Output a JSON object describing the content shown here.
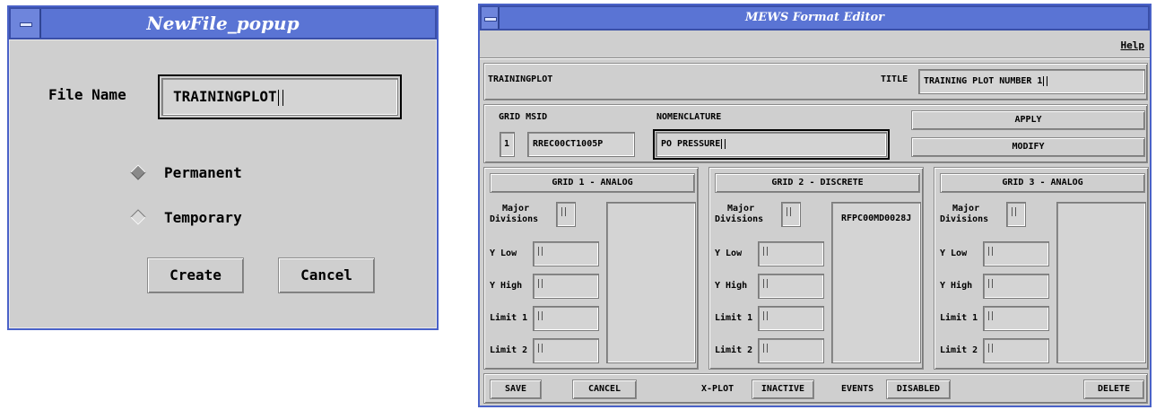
{
  "newfile_popup": {
    "title": "NewFile_popup",
    "file_name_label": "File Name",
    "file_name_value": "TRAININGPLOT",
    "options": [
      {
        "label": "Permanent",
        "selected": true
      },
      {
        "label": "Temporary",
        "selected": false
      }
    ],
    "create_label": "Create",
    "cancel_label": "Cancel"
  },
  "editor": {
    "title": "MEWS Format Editor",
    "help_label": "Help",
    "format_name": "TRAININGPLOT",
    "title_label": "TITLE",
    "title_value": "TRAINING PLOT NUMBER 1",
    "grid_msid_label": "GRID MSID",
    "grid_number": "1",
    "msid_value": "RREC00CT1005P",
    "nomenclature_label": "NOMENCLATURE",
    "nomenclature_value": "PO PRESSURE",
    "apply_label": "APPLY",
    "modify_label": "MODIFY",
    "grids": [
      {
        "header": "GRID 1 - ANALOG",
        "list_items": []
      },
      {
        "header": "GRID 2 - DISCRETE",
        "list_items": [
          "RFPC00MD0028J"
        ]
      },
      {
        "header": "GRID 3 - ANALOG",
        "list_items": []
      }
    ],
    "grid_labels": {
      "major": "Major",
      "divisions": "Divisions",
      "y_low": "Y Low",
      "y_high": "Y High",
      "limit1": "Limit 1",
      "limit2": "Limit 2"
    },
    "footer": {
      "save_label": "SAVE",
      "cancel_label": "CANCEL",
      "xplot_label": "X-PLOT",
      "xplot_value": "INACTIVE",
      "events_label": "EVENTS",
      "events_value": "DISABLED",
      "delete_label": "DELETE"
    }
  }
}
